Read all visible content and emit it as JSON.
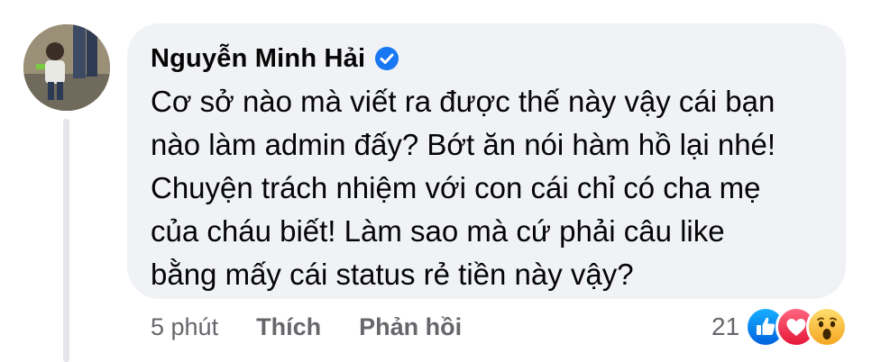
{
  "comment": {
    "author": "Nguyễn Minh Hải",
    "verified": true,
    "text_lines": [
      "Cơ sở nào mà viết ra được thế này vậy cái bạn",
      "nào làm admin đấy? Bớt ăn nói hàm hồ lại nhé!",
      "Chuyện trách nhiệm với con cái chỉ có cha mẹ",
      "của cháu biết! Làm sao mà cứ phải câu like",
      "bằng mấy cái status rẻ tiền này vậy?"
    ],
    "time": "5 phút",
    "actions": {
      "like_label": "Thích",
      "reply_label": "Phản hồi"
    },
    "reactions": {
      "count": "21",
      "icons": [
        "like-icon",
        "love-icon",
        "wow-icon"
      ]
    }
  },
  "colors": {
    "bubble_bg": "#f0f2f5",
    "verified_blue": "#1877f2",
    "secondary_text": "#65676b",
    "love_red": "#f33e58",
    "wow_yellow": "#f7b125"
  }
}
